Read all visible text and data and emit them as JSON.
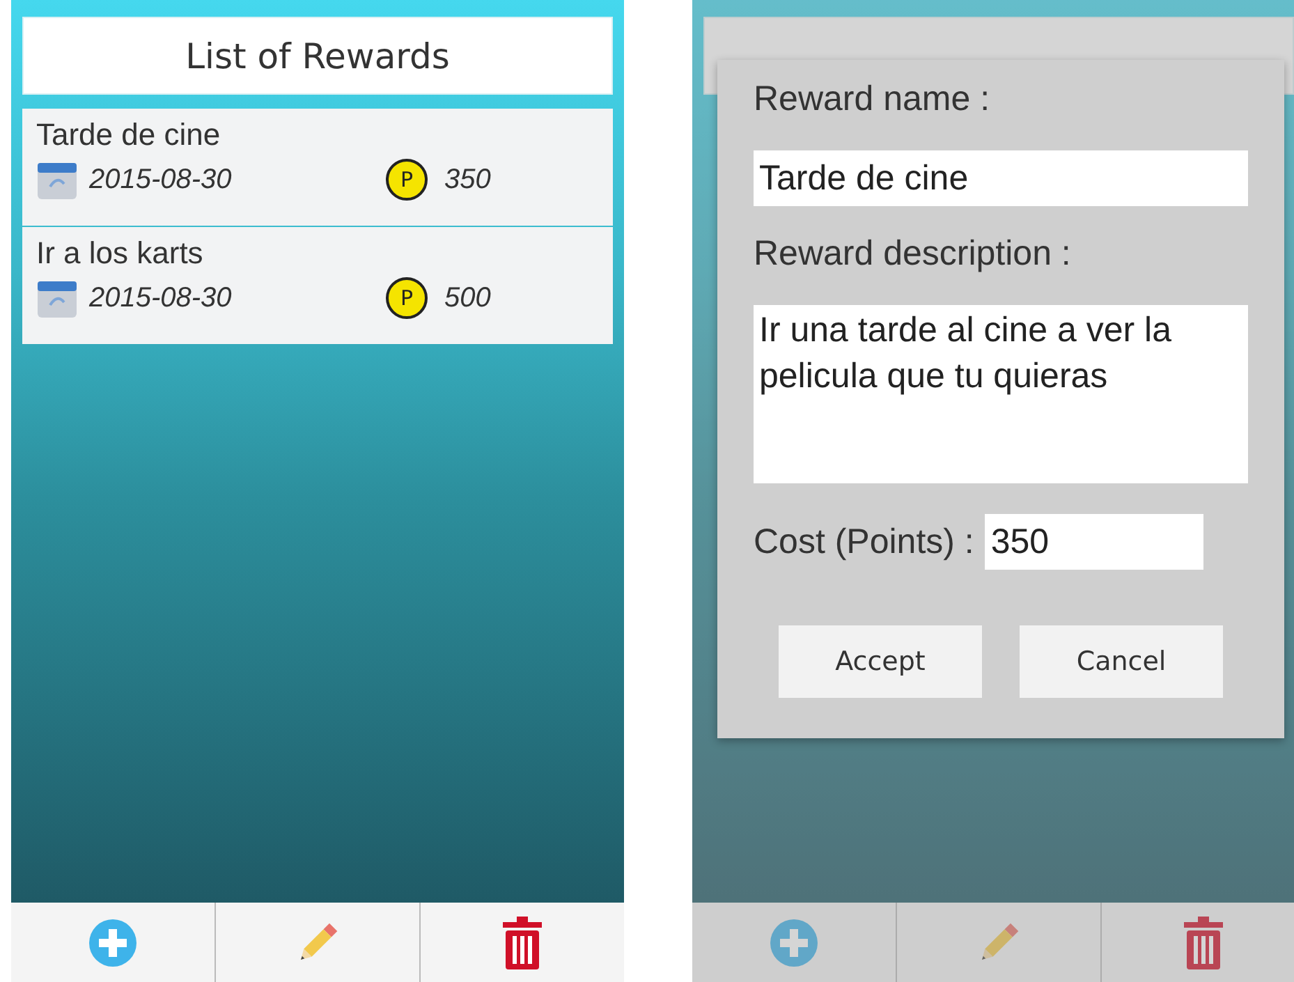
{
  "list_screen": {
    "title": "List of Rewards",
    "rewards": [
      {
        "name": "Tarde de cine",
        "date": "2015-08-30",
        "coin": "P",
        "points": "350"
      },
      {
        "name": "Ir a los karts",
        "date": "2015-08-30",
        "coin": "P",
        "points": "500"
      }
    ],
    "toolbar": [
      {
        "kind": "add"
      },
      {
        "kind": "edit"
      },
      {
        "kind": "delete"
      }
    ]
  },
  "dialog_screen": {
    "dialog": {
      "name_label": "Reward name :",
      "name_value": "Tarde de cine",
      "description_label": "Reward description :",
      "description_value": "Ir una tarde al cine a ver la pelicula que tu quieras",
      "cost_label": "Cost (Points) :",
      "cost_value": "350",
      "buttons": [
        "Accept",
        "Cancel"
      ]
    },
    "toolbar": [
      {
        "kind": "add"
      },
      {
        "kind": "edit"
      },
      {
        "kind": "delete"
      }
    ]
  }
}
